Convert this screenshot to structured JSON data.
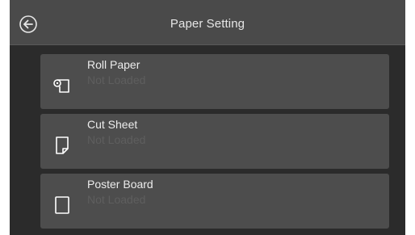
{
  "header": {
    "title": "Paper Setting",
    "back_icon": "arrow-left-circle-icon"
  },
  "items": [
    {
      "label": "Roll Paper",
      "status": "Not Loaded",
      "icon": "roll-paper-icon"
    },
    {
      "label": "Cut Sheet",
      "status": "Not Loaded",
      "icon": "cut-sheet-icon"
    },
    {
      "label": "Poster Board",
      "status": "Not Loaded",
      "icon": "poster-board-icon"
    }
  ],
  "colors": {
    "background": "#2b2b2b",
    "header": "#4a4a4a",
    "item": "#4d4d4d",
    "text": "#ececec",
    "status_text": "#5e5e5e"
  }
}
